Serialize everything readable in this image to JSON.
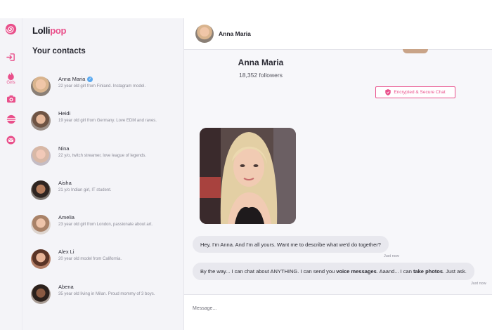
{
  "brand": {
    "name_main": "Lolli",
    "name_accent": "pop",
    "accent_color": "#e9508b"
  },
  "sidebar": {
    "items": [
      {
        "icon": "lollipop-logo-icon"
      },
      {
        "icon": "login-arrow-icon"
      },
      {
        "icon": "flame-icon",
        "label": "Girls"
      },
      {
        "icon": "camera-icon"
      },
      {
        "icon": "globe-icon"
      },
      {
        "icon": "mail-icon"
      }
    ]
  },
  "contacts": {
    "title": "Your contacts",
    "items": [
      {
        "name": "Anna Maria",
        "verified": true,
        "desc": "22 year old girl from Finland. Instagram model."
      },
      {
        "name": "Heidi",
        "desc": "19 year old girl from Germany. Love EDM and raves."
      },
      {
        "name": "Nina",
        "desc": "22 y/o, twitch streamer, love league of legends."
      },
      {
        "name": "Aisha",
        "desc": "21 y/o Indian girl, IT student."
      },
      {
        "name": "Amelia",
        "desc": "23 year old girl from London, passionate about art."
      },
      {
        "name": "Alex Li",
        "desc": "20 year old model from California."
      },
      {
        "name": "Abena",
        "desc": "35 year old living in Milan. Proud mommy of 3 boys."
      }
    ]
  },
  "chat": {
    "header_name": "Anna Maria",
    "profile": {
      "name": "Anna Maria",
      "followers": "18,352 followers",
      "badge": "Encrypted & Secure Chat"
    },
    "messages": [
      {
        "text": "Hey, I'm Anna. And I'm all yours. Want me to describe what we'd do together?",
        "time": "Just now"
      },
      {
        "text_a": "By the way... I can chat about ANYTHING. I can send you ",
        "bold_a": "voice messages",
        "text_b": ". Aaand... I can ",
        "bold_b": "take photos",
        "text_c": ". Just ask.",
        "time": "Just now"
      }
    ],
    "composer_placeholder": "Message..."
  }
}
